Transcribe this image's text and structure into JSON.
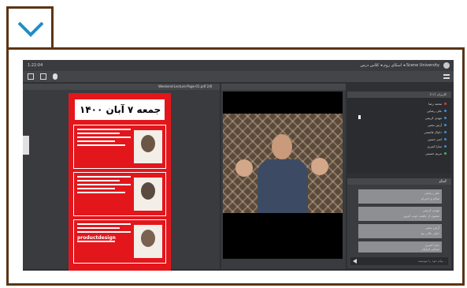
{
  "toggle": {
    "icon": "chevron-down-icon",
    "color": "#1f8ec4"
  },
  "frame_color": "#5b3414",
  "app": {
    "topbar": {
      "title": "اسکای روم ◂ کلاس درس ◂ Scene University",
      "timer": "1:22:04"
    },
    "presentation": {
      "file_name": "Weekend-Lecture-Page-01.pdf 2/8",
      "poster": {
        "heading": "جمعه ۷ آبان ۱۴۰۰",
        "blocks": [
          {
            "label": "block-1"
          },
          {
            "label": "block-2"
          },
          {
            "label": "block-3",
            "highlight": "productdesign"
          }
        ]
      }
    },
    "users": {
      "title": "کاربران (۱۱)",
      "items": [
        {
          "name": "محمد رضا",
          "color": "#e03a3a"
        },
        {
          "name": "علی رضایی",
          "color": "#3a8ee0"
        },
        {
          "name": "مهدی کریمی",
          "color": "#3a8ee0"
        },
        {
          "name": "آرش نجفی",
          "color": "#3a8ee0"
        },
        {
          "name": "دانیال قاسمی",
          "color": "#3a8ee0"
        },
        {
          "name": "امیر حسین",
          "color": "#3a8ee0"
        },
        {
          "name": "سارا امیری",
          "color": "#3a8ee0"
        },
        {
          "name": "مریم حسینی",
          "color": "#3ac060"
        }
      ]
    },
    "chat": {
      "title": "گفتگو",
      "messages": [
        {
          "author": "علی رضایی",
          "text": "سلام و احترام"
        },
        {
          "author": "مهدی کریمی",
          "text": "ممنون از جلسه خوب امروز"
        },
        {
          "author": "آرش نجفی",
          "text": "خیلی عالی بود"
        },
        {
          "author": "سارا امیری",
          "text": "سپاس فراوان"
        }
      ],
      "input_placeholder": "پیام خود را بنویسید..."
    }
  }
}
